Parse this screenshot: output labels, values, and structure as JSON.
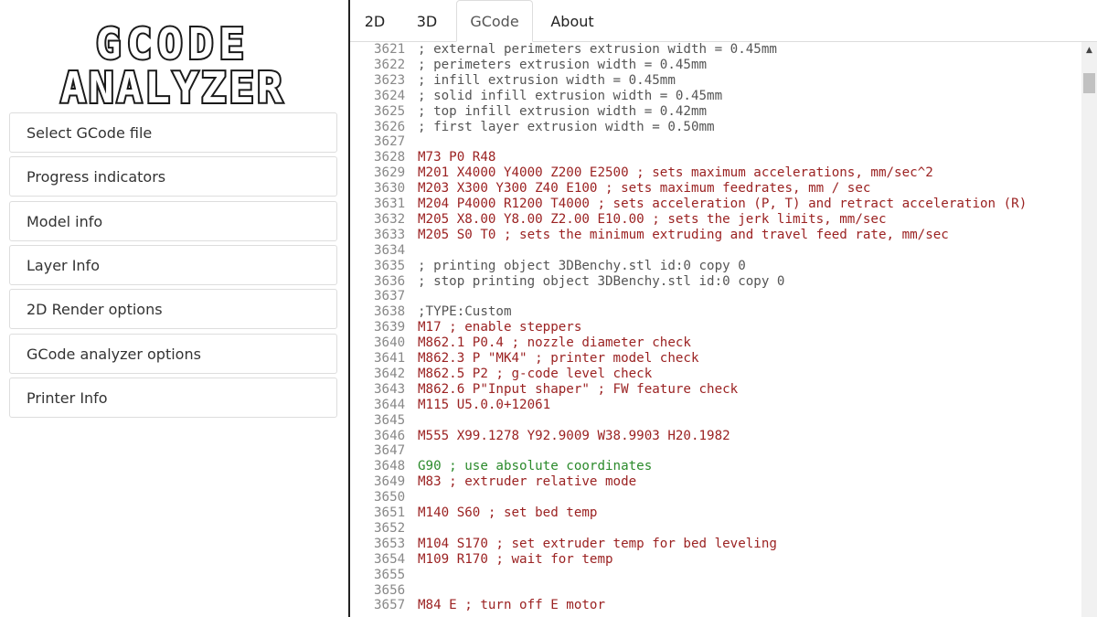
{
  "logo": {
    "line1": "GCODE",
    "line2": "ANALYZER"
  },
  "sidebar": {
    "items": [
      {
        "label": "Select GCode file"
      },
      {
        "label": "Progress indicators"
      },
      {
        "label": "Model info"
      },
      {
        "label": "Layer Info"
      },
      {
        "label": "2D Render options"
      },
      {
        "label": "GCode analyzer options"
      },
      {
        "label": "Printer Info"
      }
    ]
  },
  "tabs": [
    {
      "label": "2D",
      "active": false
    },
    {
      "label": "3D",
      "active": false
    },
    {
      "label": "GCode",
      "active": true
    },
    {
      "label": "About",
      "active": false
    }
  ],
  "colors": {
    "comment": "#555555",
    "command": "#9b2222",
    "g_command": "#2b8a2b"
  },
  "code_lines": [
    {
      "num": "3621",
      "text": "; external perimeters extrusion width = 0.45mm",
      "kind": "comment"
    },
    {
      "num": "3622",
      "text": "; perimeters extrusion width = 0.45mm",
      "kind": "comment"
    },
    {
      "num": "3623",
      "text": "; infill extrusion width = 0.45mm",
      "kind": "comment"
    },
    {
      "num": "3624",
      "text": "; solid infill extrusion width = 0.45mm",
      "kind": "comment"
    },
    {
      "num": "3625",
      "text": "; top infill extrusion width = 0.42mm",
      "kind": "comment"
    },
    {
      "num": "3626",
      "text": "; first layer extrusion width = 0.50mm",
      "kind": "comment"
    },
    {
      "num": "3627",
      "text": "",
      "kind": "comment"
    },
    {
      "num": "3628",
      "text": "M73 P0 R48",
      "kind": "cmd"
    },
    {
      "num": "3629",
      "text": "M201 X4000 Y4000 Z200 E2500 ; sets maximum accelerations, mm/sec^2",
      "kind": "cmd"
    },
    {
      "num": "3630",
      "text": "M203 X300 Y300 Z40 E100 ; sets maximum feedrates, mm / sec",
      "kind": "cmd"
    },
    {
      "num": "3631",
      "text": "M204 P4000 R1200 T4000 ; sets acceleration (P, T) and retract acceleration (R)",
      "kind": "cmd"
    },
    {
      "num": "3632",
      "text": "M205 X8.00 Y8.00 Z2.00 E10.00 ; sets the jerk limits, mm/sec",
      "kind": "cmd"
    },
    {
      "num": "3633",
      "text": "M205 S0 T0 ; sets the minimum extruding and travel feed rate, mm/sec",
      "kind": "cmd"
    },
    {
      "num": "3634",
      "text": "",
      "kind": "comment"
    },
    {
      "num": "3635",
      "text": "; printing object 3DBenchy.stl id:0 copy 0",
      "kind": "comment"
    },
    {
      "num": "3636",
      "text": "; stop printing object 3DBenchy.stl id:0 copy 0",
      "kind": "comment"
    },
    {
      "num": "3637",
      "text": "",
      "kind": "comment"
    },
    {
      "num": "3638",
      "text": ";TYPE:Custom",
      "kind": "comment"
    },
    {
      "num": "3639",
      "text": "M17 ; enable steppers",
      "kind": "cmd"
    },
    {
      "num": "3640",
      "text": "M862.1 P0.4 ; nozzle diameter check",
      "kind": "cmd"
    },
    {
      "num": "3641",
      "text": "M862.3 P \"MK4\" ; printer model check",
      "kind": "cmd"
    },
    {
      "num": "3642",
      "text": "M862.5 P2 ; g-code level check",
      "kind": "cmd"
    },
    {
      "num": "3643",
      "text": "M862.6 P\"Input shaper\" ; FW feature check",
      "kind": "cmd"
    },
    {
      "num": "3644",
      "text": "M115 U5.0.0+12061",
      "kind": "cmd"
    },
    {
      "num": "3645",
      "text": "",
      "kind": "comment"
    },
    {
      "num": "3646",
      "text": "M555 X99.1278 Y92.9009 W38.9903 H20.1982",
      "kind": "cmd"
    },
    {
      "num": "3647",
      "text": "",
      "kind": "comment"
    },
    {
      "num": "3648",
      "text": "G90 ; use absolute coordinates",
      "kind": "g"
    },
    {
      "num": "3649",
      "text": "M83 ; extruder relative mode",
      "kind": "cmd"
    },
    {
      "num": "3650",
      "text": "",
      "kind": "comment"
    },
    {
      "num": "3651",
      "text": "M140 S60 ; set bed temp",
      "kind": "cmd"
    },
    {
      "num": "3652",
      "text": "",
      "kind": "comment"
    },
    {
      "num": "3653",
      "text": "M104 S170 ; set extruder temp for bed leveling",
      "kind": "cmd"
    },
    {
      "num": "3654",
      "text": "M109 R170 ; wait for temp",
      "kind": "cmd"
    },
    {
      "num": "3655",
      "text": "",
      "kind": "comment"
    },
    {
      "num": "3656",
      "text": "",
      "kind": "comment"
    },
    {
      "num": "3657",
      "text": "M84 E ; turn off E motor",
      "kind": "cmd"
    }
  ]
}
